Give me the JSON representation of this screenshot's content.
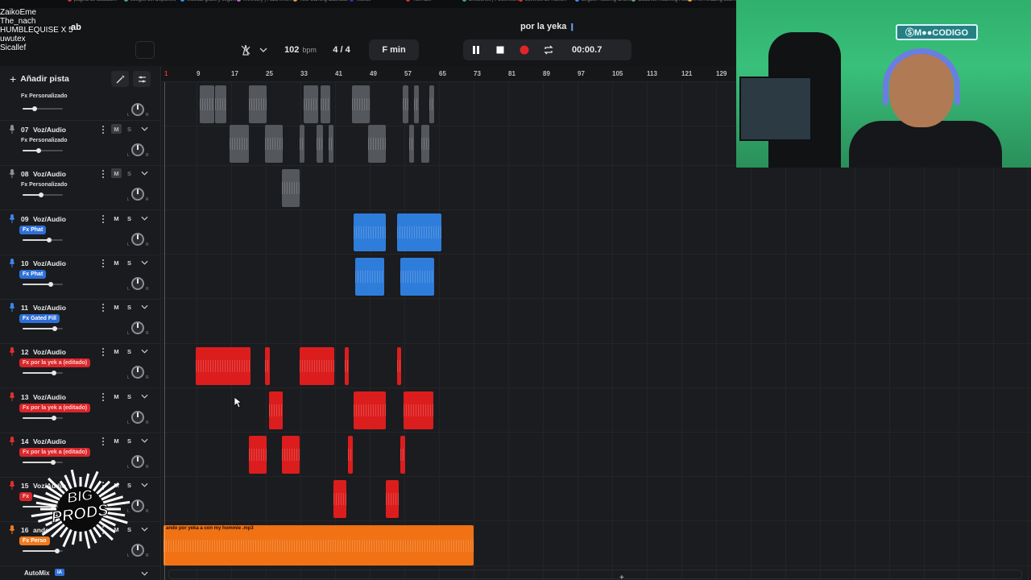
{
  "chat": {
    "lines": [
      "ZaikoEme",
      "The_nach",
      "HUMBLEQUISE X 5",
      "uwutex",
      "Sicallef"
    ],
    "tail": "ab"
  },
  "topbar": {
    "project_title": "por la yeka",
    "tempo_value": "102",
    "tempo_unit": "bpm",
    "time_signature": "4 / 4",
    "key": "F min",
    "time_display": "00:00.7"
  },
  "sidebar": {
    "add_track_label": "Añadir pista",
    "automix_label": "AutoMix",
    "automix_badge": "IA",
    "partial_track": {
      "fx": "Fx Personalizado",
      "volume": 0.3
    },
    "tracks": [
      {
        "number": "07",
        "name": "Voz/Audio",
        "fx": "Fx Personalizado",
        "fx_style": "plain",
        "icon_color": "#8a8d93",
        "muted": true,
        "volume": 0.4
      },
      {
        "number": "08",
        "name": "Voz/Audio",
        "fx": "Fx Personalizado",
        "fx_style": "plain",
        "icon_color": "#8a8d93",
        "muted": true,
        "volume": 0.45
      },
      {
        "number": "09",
        "name": "Voz/Audio",
        "fx": "Fx Phat",
        "fx_style": "blue",
        "icon_color": "#3c86e6",
        "muted": false,
        "volume": 0.65
      },
      {
        "number": "10",
        "name": "Voz/Audio",
        "fx": "Fx Phat",
        "fx_style": "blue",
        "icon_color": "#3c86e6",
        "muted": false,
        "volume": 0.7
      },
      {
        "number": "11",
        "name": "Voz/Audio",
        "fx": "Fx Gated Fill",
        "fx_style": "blue",
        "icon_color": "#3c86e6",
        "muted": false,
        "volume": 0.8
      },
      {
        "number": "12",
        "name": "Voz/Audio",
        "fx": "Fx por la yek a (editado)",
        "fx_style": "red",
        "icon_color": "#e0302f",
        "muted": false,
        "volume": 0.78
      },
      {
        "number": "13",
        "name": "Voz/Audio",
        "fx": "Fx por la yek a (editado)",
        "fx_style": "red",
        "icon_color": "#e0302f",
        "muted": false,
        "volume": 0.78
      },
      {
        "number": "14",
        "name": "Voz/Audio",
        "fx": "Fx por la yek a (editado)",
        "fx_style": "red",
        "icon_color": "#e0302f",
        "muted": false,
        "volume": 0.75
      },
      {
        "number": "15",
        "name": "Voz/Audio",
        "fx": "Fx",
        "fx_style": "red",
        "icon_color": "#e0302f",
        "muted": false,
        "volume": 0.75
      },
      {
        "number": "16",
        "name": "ando",
        "fx": "Fx Perso",
        "fx_style": "orange",
        "icon_color": "#f07a1f",
        "muted": false,
        "volume": 0.85
      }
    ],
    "mute_label": "M",
    "solo_label": "S",
    "pan_l": "L",
    "pan_r": "R"
  },
  "timeline": {
    "ruler": [
      "1",
      "9",
      "17",
      "25",
      "33",
      "41",
      "49",
      "57",
      "65",
      "73",
      "81",
      "89",
      "97",
      "105",
      "113",
      "121",
      "129"
    ],
    "orange_clip_label": "ando por yeka a con my hommie .mp3"
  },
  "webcam": {
    "neon_sign": "ⓈM●●CODIGO"
  },
  "logo": {
    "line1": "BIG",
    "line2": "PRODS"
  },
  "browser": {
    "bookmarks": [
      "página de actualiz...",
      "Juegos del Deportivo",
      "Música, gratis y segur...",
      "Inventory | Faza Inhe...",
      "Toto Gaming Cashbac",
      "Videos",
      "YouTube",
      "Divisiones | PowerMu...",
      "Jovenes de Ruhu...",
      "English Tutoring Online",
      "Coaches Roaming Roun...",
      "The Amazing Journal"
    ]
  },
  "colors": {
    "grey_clip": "#54575c",
    "blue_clip": "#2f7ddb",
    "red_clip": "#dc1d1d",
    "orange_clip": "#f07214",
    "record": "#e0252a"
  }
}
